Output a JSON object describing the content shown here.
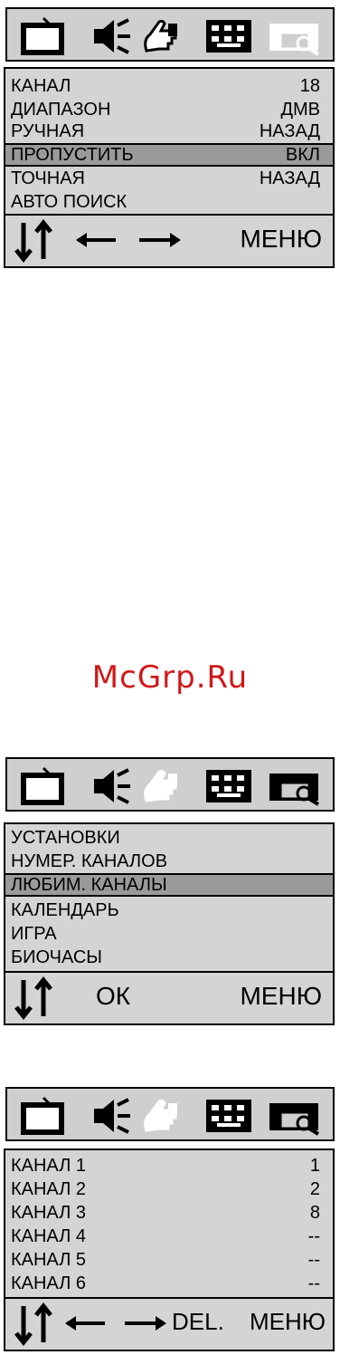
{
  "watermark": "McGrp.Ru",
  "icons": [
    "tv-icon",
    "speaker-icon",
    "hand-icon",
    "grid-icon",
    "screen-icon"
  ],
  "panel1": {
    "rows": [
      {
        "label": "КАНАЛ",
        "value": "18"
      },
      {
        "label": "ДИАПАЗОН",
        "value": "ДМВ"
      },
      {
        "label": "РУЧНАЯ",
        "value": "НАЗАД"
      },
      {
        "label": "ПРОПУСТИТЬ",
        "value": "ВКЛ",
        "selected": true
      },
      {
        "label": "ТОЧНАЯ",
        "value": "НАЗАД"
      },
      {
        "label": "АВТО ПОИСК",
        "value": ""
      }
    ],
    "footer": {
      "menu": "МЕНЮ"
    }
  },
  "panel2": {
    "rows": [
      {
        "label": "УСТАНОВКИ"
      },
      {
        "label": "НУМЕР. КАНАЛОВ"
      },
      {
        "label": "ЛЮБИМ. КАНАЛЫ",
        "selected": true
      },
      {
        "label": "КАЛЕНДАРЬ"
      },
      {
        "label": "ИГРА"
      },
      {
        "label": "БИОЧАСЫ"
      }
    ],
    "footer": {
      "ok": "ОК",
      "menu": "МЕНЮ"
    }
  },
  "panel3": {
    "rows": [
      {
        "label": "КАНАЛ 1",
        "value": "1"
      },
      {
        "label": "КАНАЛ 2",
        "value": "2"
      },
      {
        "label": "КАНАЛ 3",
        "value": "8"
      },
      {
        "label": "КАНАЛ 4",
        "value": "--"
      },
      {
        "label": "КАНАЛ 5",
        "value": "--"
      },
      {
        "label": "КАНАЛ 6",
        "value": "--"
      }
    ],
    "footer": {
      "del": "DEL.",
      "menu": "МЕНЮ"
    }
  }
}
